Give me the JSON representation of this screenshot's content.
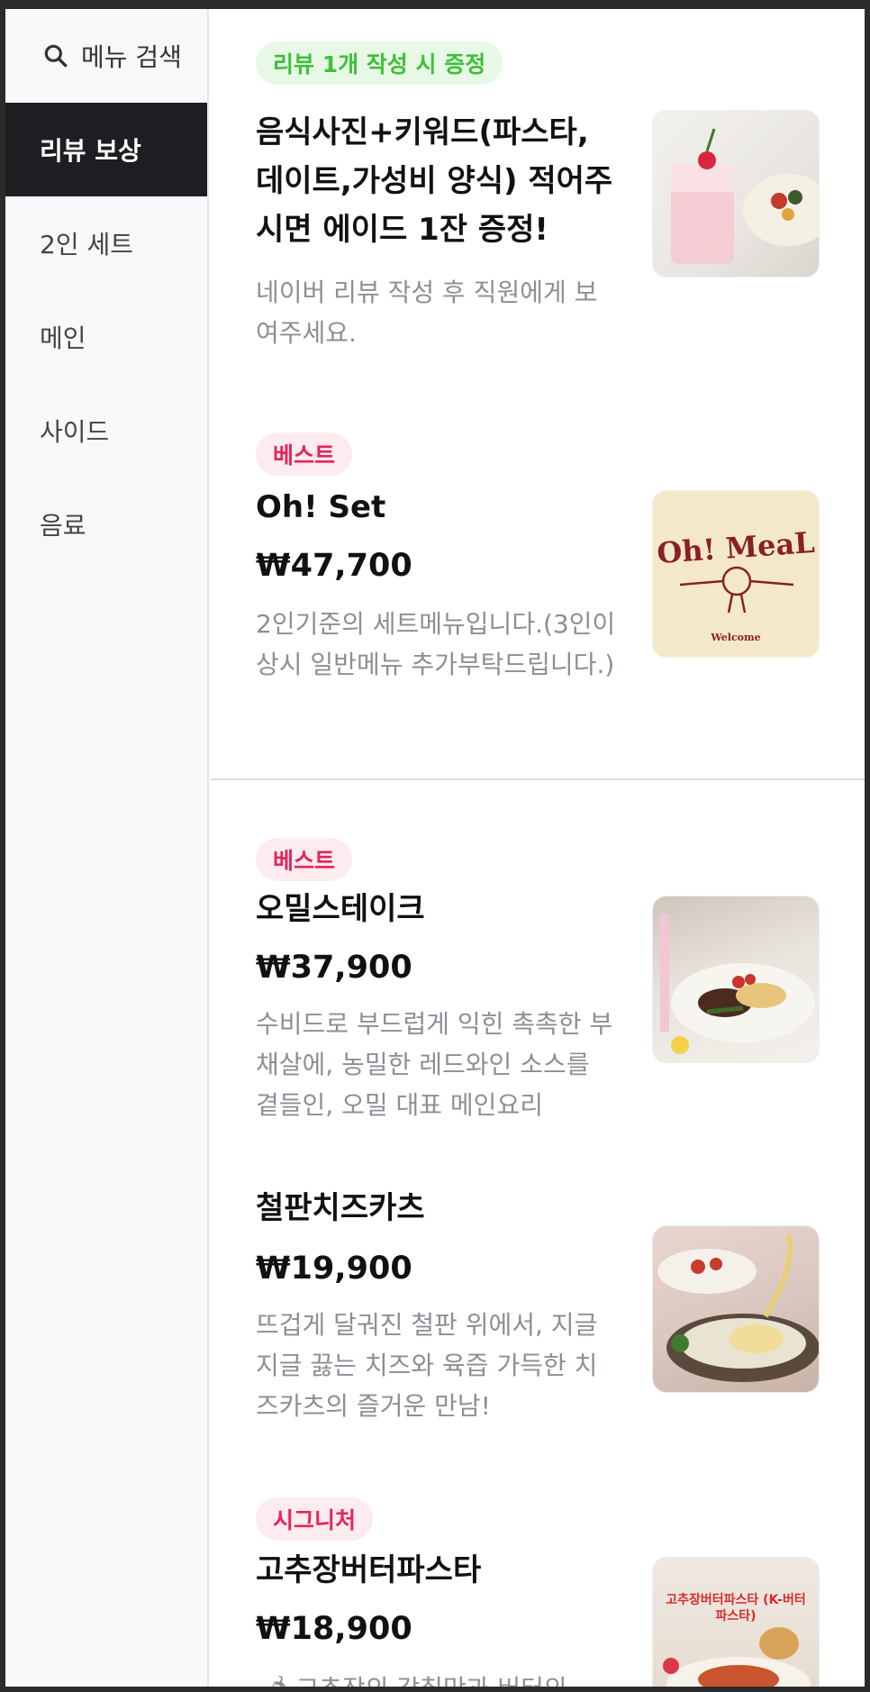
{
  "sidebar": {
    "search_label": "메뉴 검색",
    "items": [
      {
        "label": "리뷰 보상",
        "active": true
      },
      {
        "label": "2인 세트"
      },
      {
        "label": "메인"
      },
      {
        "label": "사이드"
      },
      {
        "label": "음료"
      }
    ]
  },
  "menu": {
    "review": {
      "badge": "리뷰 1개 작성 시 증정",
      "title": "음식사진+키워드(파스타, 데이트,가성비 양식) 적어주시면 에이드 1잔 증정!",
      "desc": "네이버 리뷰 작성 후 직원에게 보여주세요.",
      "image": "ade-drink-photo"
    },
    "ohset": {
      "badge": "베스트",
      "title": "Oh! Set",
      "price": "₩47,700",
      "desc": "2인기준의 세트메뉴입니다.(3인이상시 일반메뉴 추가부탁드립니다.)",
      "logo_title": "Oh! MeaL",
      "logo_sub": "Welcome"
    },
    "steak": {
      "badge": "베스트",
      "title": "오밀스테이크",
      "price": "₩37,900",
      "desc": "수비드로 부드럽게 익힌 촉촉한 부채살에, 농밀한 레드와인 소스를 곁들인, 오밀 대표 메인요리",
      "image": "steak-plate-photo"
    },
    "katsu": {
      "title": "철판치즈카츠",
      "price": "₩19,900",
      "desc": "뜨겁게 달궈진 철판 위에서, 지글지글 끓는 치즈와 육즙 가득한 치즈카츠의 즐거운 만남!",
      "image": "cheese-katsu-photo"
    },
    "pasta": {
      "badge": "시그니처",
      "title": "고추장버터파스타",
      "price": "₩18,900",
      "desc": "🌶 고추장의 감칠맛과 버터의",
      "image_text": "고추장버터파스타 (K-버터 파스타)"
    }
  },
  "colors": {
    "active_bg": "#1d1e21",
    "green_badge": "#3fbf3a",
    "pink_badge": "#e5245a"
  }
}
